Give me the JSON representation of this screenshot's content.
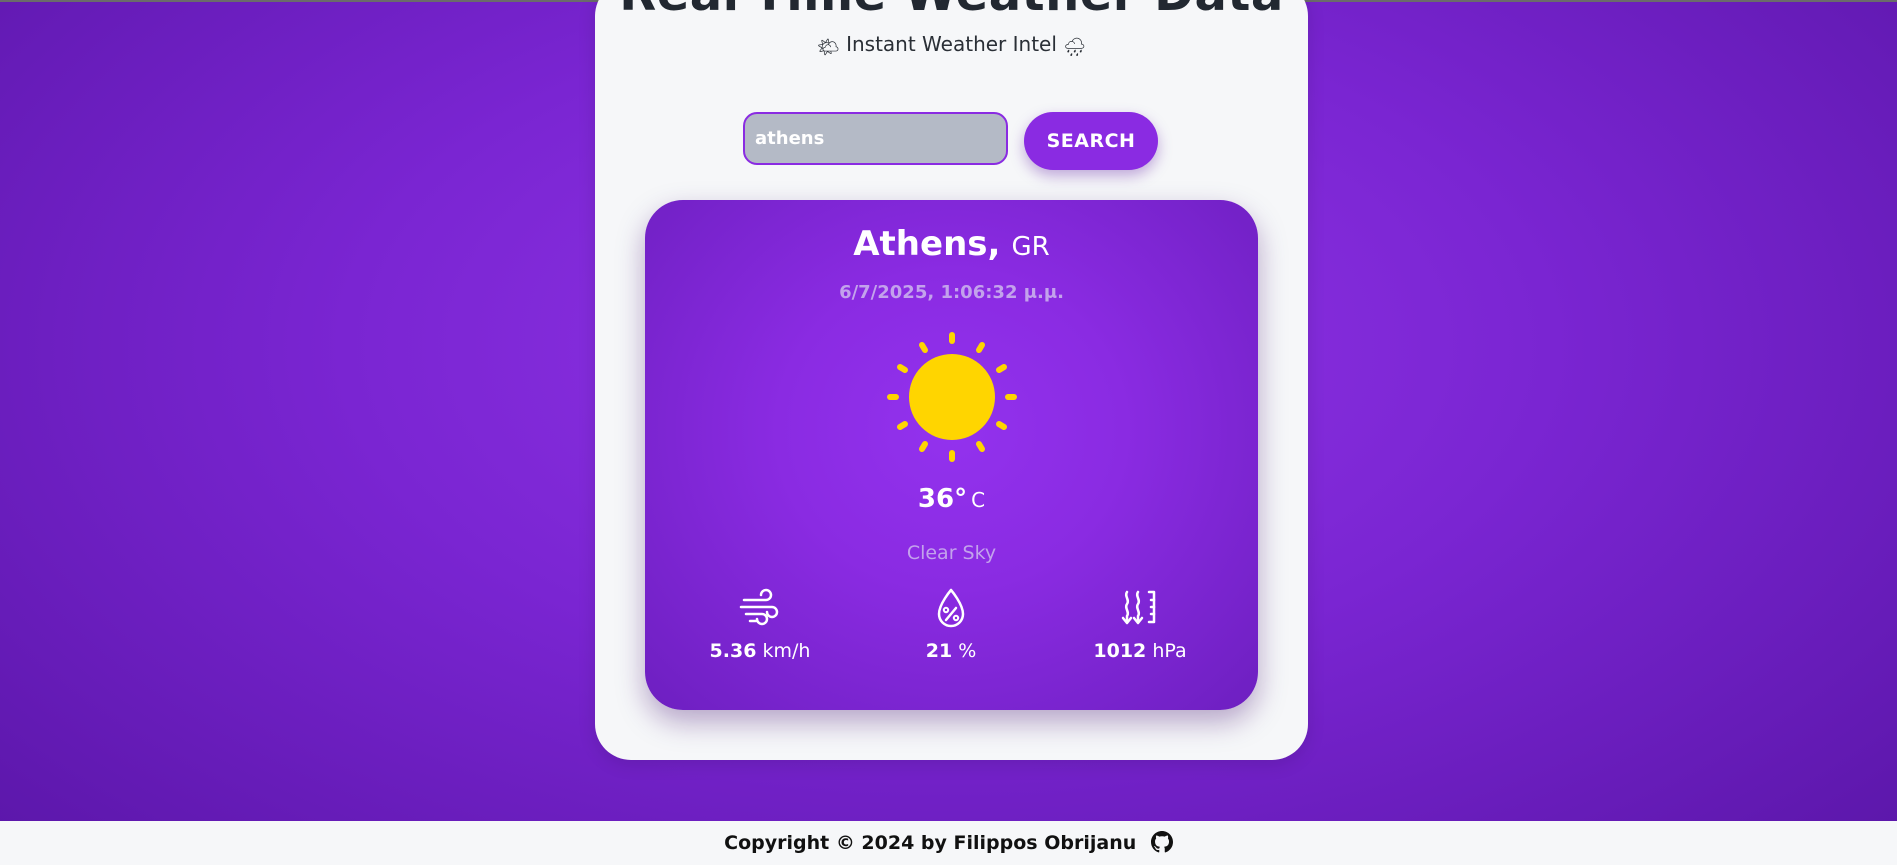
{
  "header": {
    "title": "Real-Time Weather Data",
    "subtitle": "Instant Weather Intel",
    "subtitle_icon_left": "sun-behind-cloud-icon",
    "subtitle_icon_right": "cloud-with-rain-icon"
  },
  "search": {
    "value": "athens",
    "button_label": "SEARCH"
  },
  "weather": {
    "city": "Athens,",
    "country": "GR",
    "datetime": "6/7/2025, 1:06:32 μ.μ.",
    "icon": "sun-icon",
    "temperature": "36°",
    "temperature_unit": "C",
    "condition": "Clear Sky",
    "stats": {
      "wind": {
        "icon": "wind-icon",
        "value": "5.36",
        "unit": "km/h"
      },
      "humidity": {
        "icon": "humidity-drop-icon",
        "value": "21",
        "unit": "%"
      },
      "pressure": {
        "icon": "pressure-icon",
        "value": "1012",
        "unit": "hPa"
      }
    }
  },
  "footer": {
    "copyright": "Copyright © 2024 by Filippos Obrijanu",
    "icon": "github-icon"
  },
  "colors": {
    "accent": "#8a2be2",
    "sun": "#ffd500",
    "panel": "#f6f7f9"
  }
}
